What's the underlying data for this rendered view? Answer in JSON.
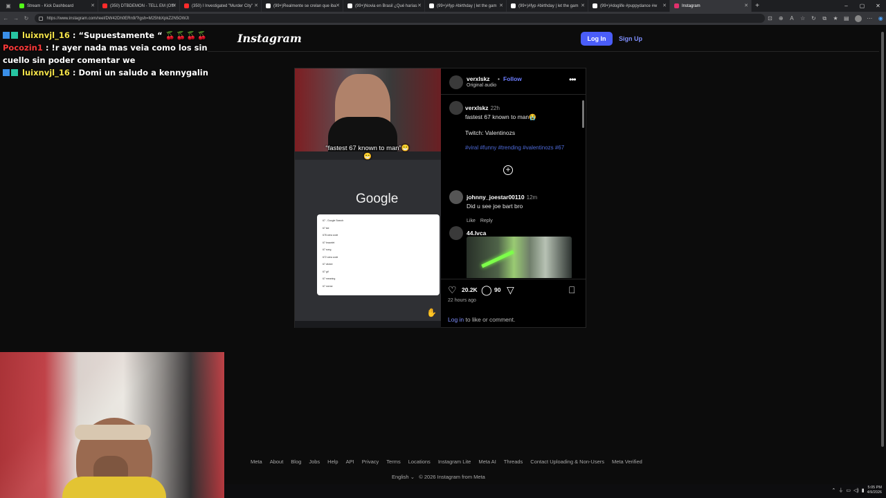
{
  "browser": {
    "tabs": [
      {
        "label": "Stream - Kick Dashboard",
        "color": "#53fc18"
      },
      {
        "label": "(350) DTBDEMON - TELL EM (Offi",
        "color": "#ff2b2b"
      },
      {
        "label": "(350) I Investigated \"Murder City\"",
        "color": "#ff2b2b"
      },
      {
        "label": "(99+)Realmente se crelan que iba",
        "color": "#ffffff"
      },
      {
        "label": "(99+)Novia en Brasil ¿Qué harías",
        "color": "#ffffff"
      },
      {
        "label": "(99+)#fyp #birthday | let the gam",
        "color": "#ffffff"
      },
      {
        "label": "(99+)#fyp #birthday | let the gam",
        "color": "#ffffff"
      },
      {
        "label": "(99+)#doglife #puppydance #w",
        "color": "#ffffff"
      },
      {
        "label": "Instagram",
        "color": "#e1306c"
      }
    ],
    "url": "https://www.instagram.com/reel/DW42Dh0ERn9/?igsh=M25hbXpkZ2N5OWJt"
  },
  "chat": {
    "lines": [
      {
        "user": "luixnvjl_16",
        "text": ": “Supuestamente “",
        "emotes": "🍒🍒🍒🍒🍒"
      },
      {
        "user": "Pocozin1",
        "text": ": !r ayer nada mas veia como los sin cuello sin poder comentar we"
      },
      {
        "user": "luixnvjl_16",
        "text": ": Domi un saludo a kennygalindo"
      }
    ]
  },
  "instagram": {
    "logo": "Instagram",
    "login_label": "Log In",
    "signup_label": "Sign Up"
  },
  "post": {
    "overlay_caption": "“fastest 67 known to man”😁😁",
    "google_logo": "Google",
    "suggestions": [
      "67 - Google Search",
      "67 kid",
      "678 area code",
      "67 bracelet",
      "67 song",
      "672 area code",
      "67 clicker",
      "67 gif",
      "67 meaning",
      "67 meme"
    ],
    "author": "verxlskz",
    "separator": "•",
    "follow": "Follow",
    "audio": "Original audio",
    "caption_user": "verxlskz",
    "caption_time": "22h",
    "caption_text": "fastest 67 known to man😭",
    "caption_twitch": "Twitch: Valentinozs",
    "caption_tags": "#viral #funny #trending #valentinozs #67",
    "comments": [
      {
        "user": "johnny_joestar00110",
        "time": "12m",
        "text": "Did u see joe bart bro",
        "like": "Like",
        "reply": "Reply"
      },
      {
        "user": "44.lvca"
      }
    ],
    "likes": "20.2K",
    "comment_count": "90",
    "time_ago": "22 hours ago",
    "login_prompt_link": "Log in",
    "login_prompt_rest": " to like or comment."
  },
  "footer": {
    "links": [
      "Meta",
      "About",
      "Blog",
      "Jobs",
      "Help",
      "API",
      "Privacy",
      "Terms",
      "Locations",
      "Instagram Lite",
      "Meta AI",
      "Threads",
      "Contact Uploading & Non-Users",
      "Meta Verified"
    ],
    "language": "English",
    "copyright": "© 2026 Instagram from Meta"
  },
  "taskbar": {
    "time": "5:05 PM",
    "date": "4/9/2026"
  }
}
